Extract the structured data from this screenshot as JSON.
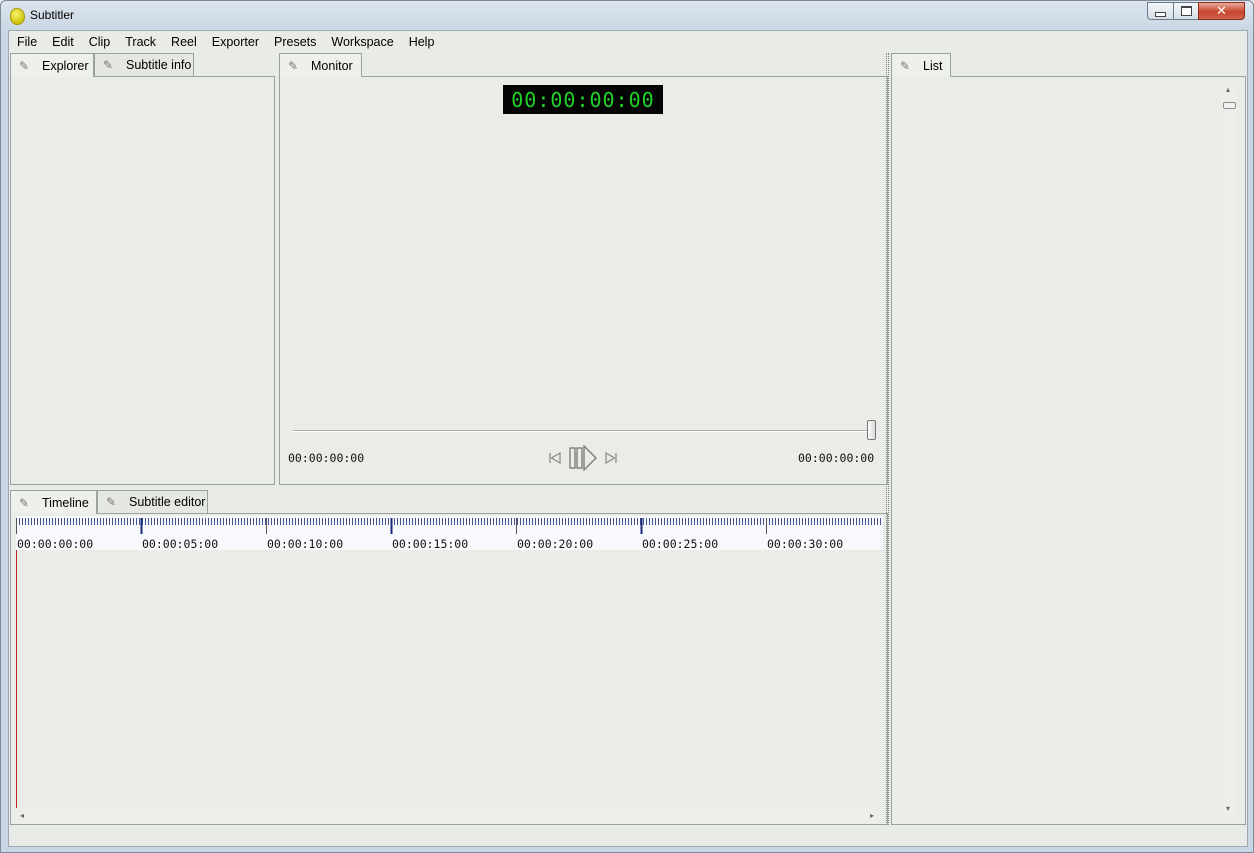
{
  "window": {
    "title": "Subtitler",
    "close_glyph": "✕"
  },
  "menu": [
    "File",
    "Edit",
    "Clip",
    "Track",
    "Reel",
    "Exporter",
    "Presets",
    "Workspace",
    "Help"
  ],
  "left_tabs": {
    "explorer": "Explorer",
    "subtitle_info": "Subtitle info"
  },
  "monitor": {
    "tab": "Monitor",
    "timecode": "00:00:00:00",
    "start_time": "00:00:00:00",
    "end_time": "00:00:00:00",
    "seek_position": 1.0
  },
  "bottom_tabs": {
    "timeline": "Timeline",
    "subtitle_editor": "Subtitle editor"
  },
  "timeline": {
    "ruler_labels": [
      "00:00:00:00",
      "00:00:05:00",
      "00:00:10:00",
      "00:00:15:00",
      "00:00:20:00",
      "00:00:25:00",
      "00:00:30:00"
    ],
    "playhead_time": "00:00:00:00"
  },
  "list_panel": {
    "tab": "List"
  },
  "icons": {
    "tab_icon": "wrench-icon",
    "prev": "skip-back-icon",
    "play_pause": "play-pause-icon",
    "next": "skip-forward-icon"
  },
  "colors": {
    "timecode_fg": "#22d22a",
    "timecode_bg": "#050505",
    "playhead": "#c0262a",
    "ruler_ticks": "#1a2a7a"
  }
}
